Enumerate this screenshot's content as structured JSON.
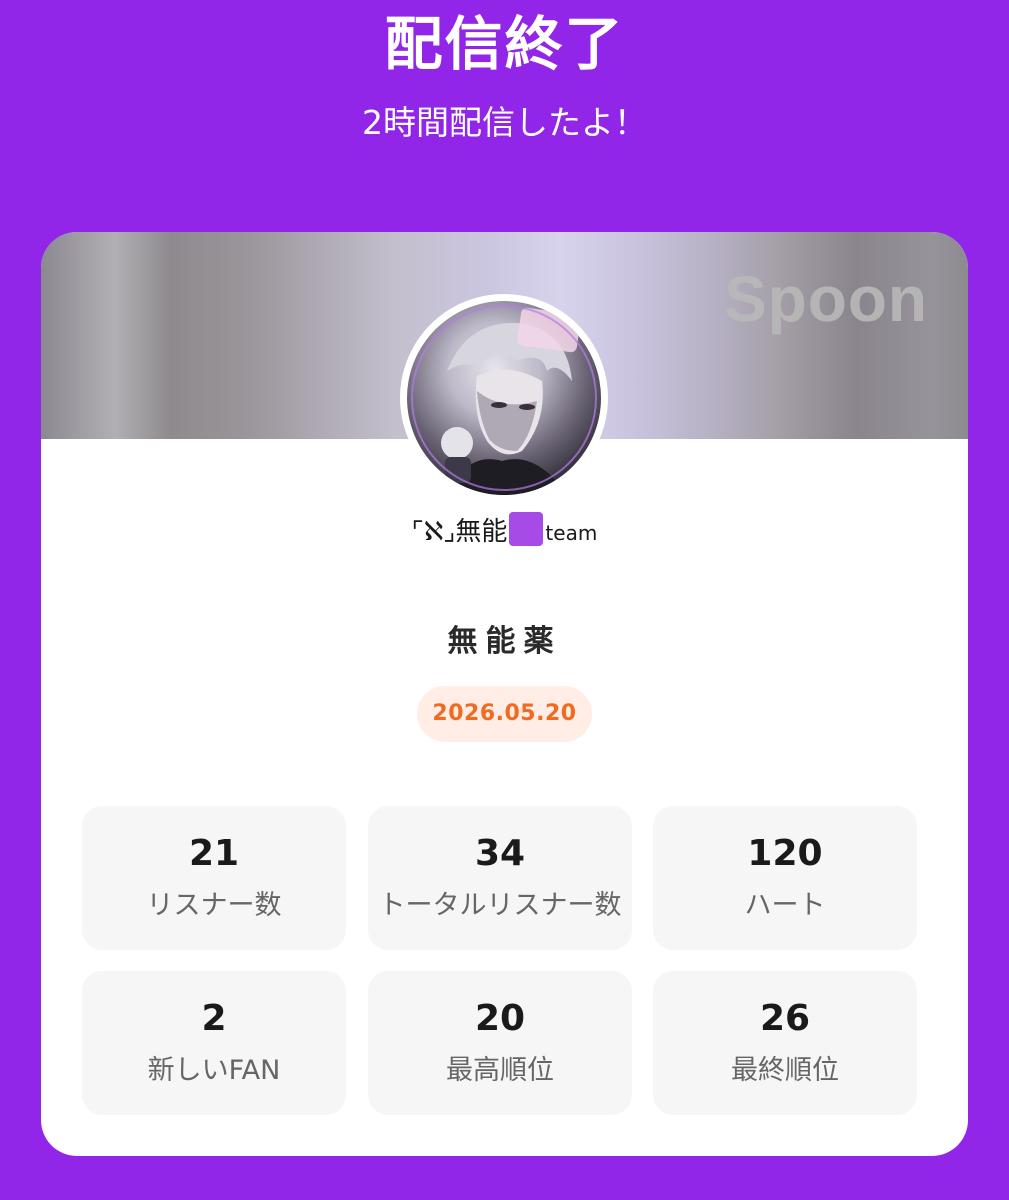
{
  "header": {
    "title": "配信終了",
    "subtitle": "2時間配信したよ！"
  },
  "card": {
    "brand": "Spoon",
    "username_prefix": "⌜ℵ⌟無能",
    "username_suffix": "team",
    "title": "無能薬",
    "date": "2026.05.20"
  },
  "stats": [
    {
      "value": "21",
      "label": "リスナー数"
    },
    {
      "value": "34",
      "label": "トータルリスナー数"
    },
    {
      "value": "120",
      "label": "ハート"
    },
    {
      "value": "2",
      "label": "新しいFAN"
    },
    {
      "value": "20",
      "label": "最高順位"
    },
    {
      "value": "26",
      "label": "最終順位"
    }
  ],
  "colors": {
    "background": "#9226E8",
    "date_text": "#F26A20",
    "date_badge": "#FFEDE6",
    "tile": "#F6F6F6"
  }
}
